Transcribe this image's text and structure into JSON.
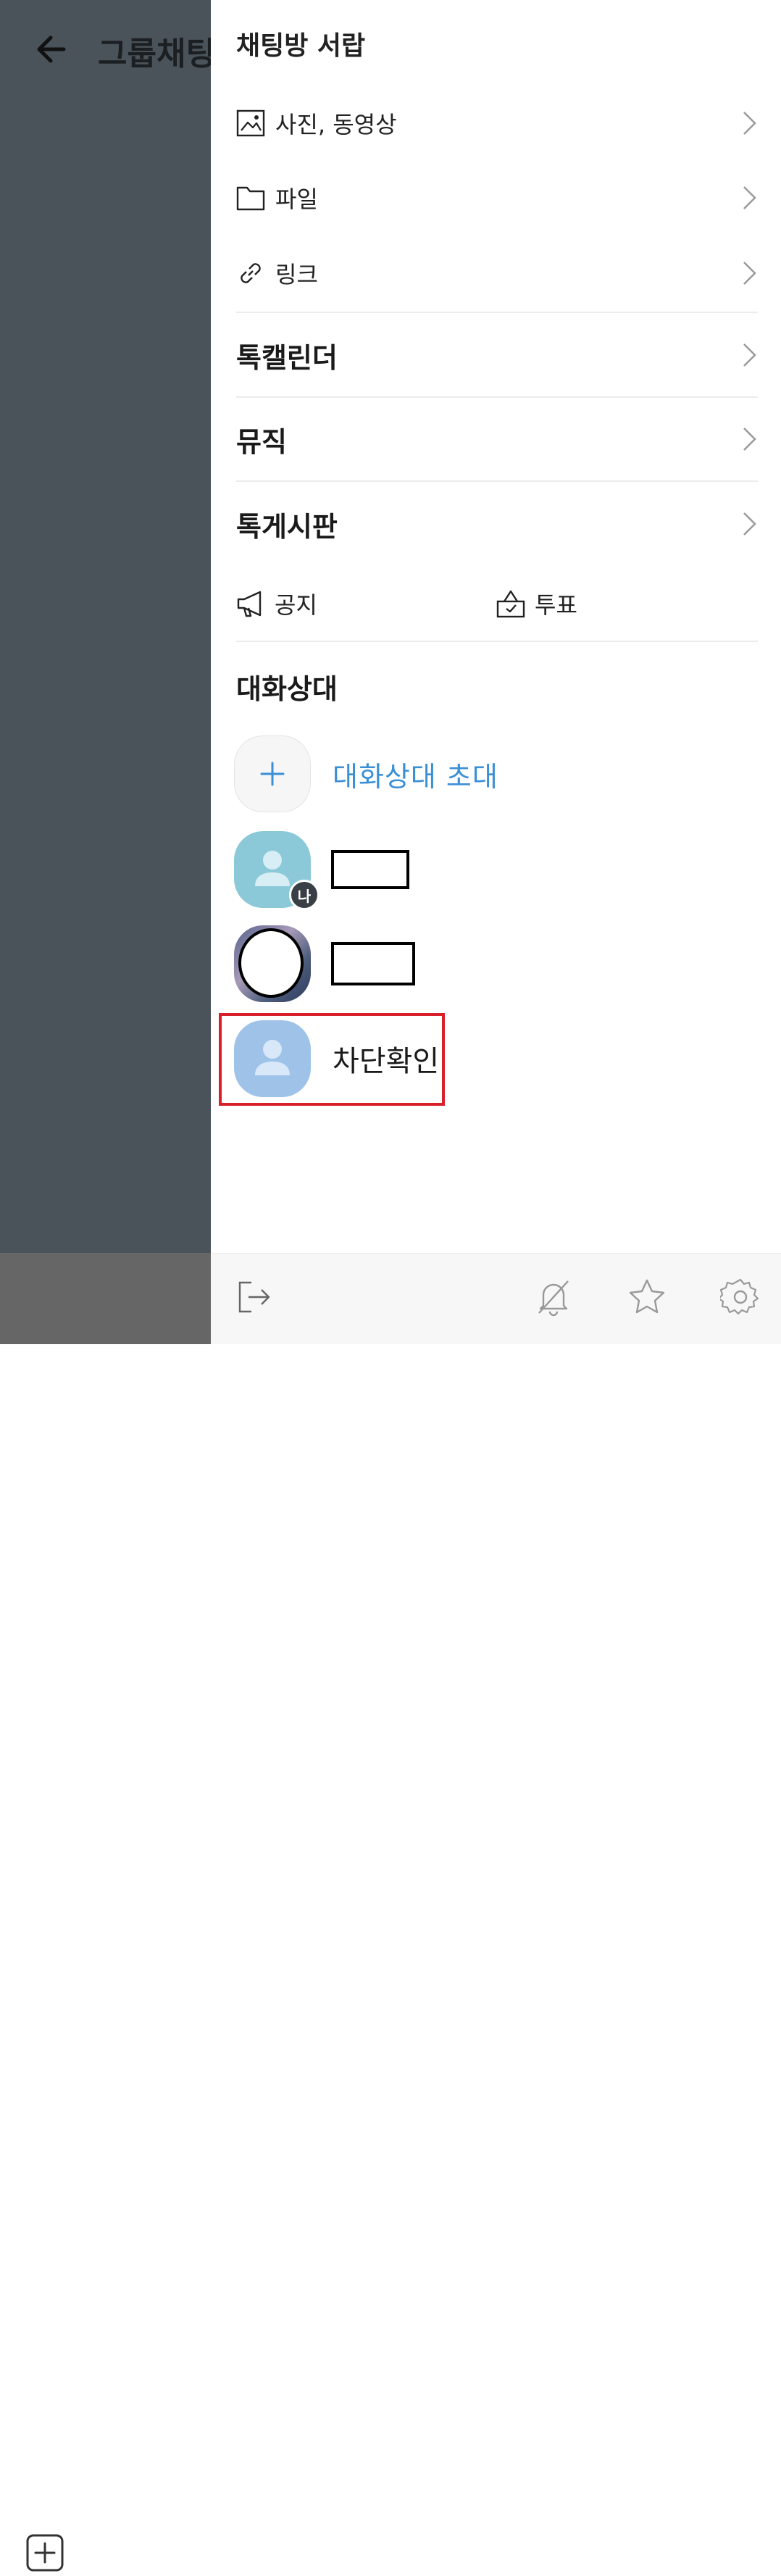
{
  "background": {
    "title": "그룹채팅"
  },
  "drawer": {
    "title": "채팅방 서랍",
    "storage": [
      {
        "label": "사진, 동영상",
        "icon": "image-icon"
      },
      {
        "label": "파일",
        "icon": "folder-icon"
      },
      {
        "label": "링크",
        "icon": "link-icon"
      }
    ],
    "features": [
      {
        "label": "톡캘린더"
      },
      {
        "label": "뮤직"
      },
      {
        "label": "톡게시판"
      }
    ],
    "notice_label": "공지",
    "vote_label": "투표",
    "participants_title": "대화상대",
    "invite_label": "대화상대 초대",
    "me_badge": "나",
    "blocked_member_name": "차단확인"
  },
  "colors": {
    "accent": "#3a8fd6",
    "highlight": "#d9202a",
    "overlay": "#4a525a"
  },
  "footer_icons": [
    "exit-icon",
    "notification-off-icon",
    "star-icon",
    "settings-icon"
  ]
}
